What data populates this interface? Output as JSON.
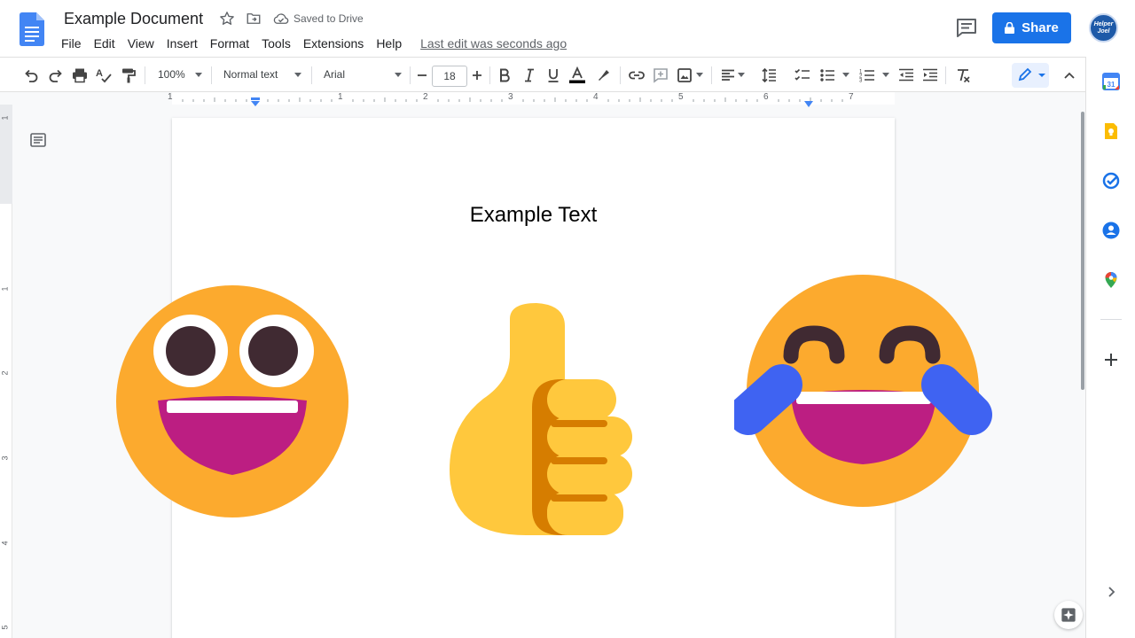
{
  "document": {
    "title": "Example Document",
    "save_status": "Saved to Drive",
    "last_edit": "Last edit was seconds ago",
    "body_heading": "Example Text"
  },
  "menu": [
    "File",
    "Edit",
    "View",
    "Insert",
    "Format",
    "Tools",
    "Extensions",
    "Help"
  ],
  "header": {
    "share_label": "Share",
    "avatar_text": "Helper Joel"
  },
  "toolbar": {
    "zoom": "100%",
    "paragraph_style": "Normal text",
    "font": "Arial",
    "font_size": "18"
  },
  "ruler": {
    "horizontal_labels": [
      "1",
      "1",
      "2",
      "3",
      "4",
      "5",
      "6",
      "7"
    ],
    "vertical_labels": [
      "1",
      "1",
      "2",
      "3",
      "4",
      "5"
    ]
  },
  "side_panel": [
    "calendar-icon",
    "keep-icon",
    "tasks-icon",
    "contacts-icon",
    "maps-icon",
    "add-icon"
  ],
  "colors": {
    "accent": "#1a73e8",
    "emoji_yellow": "#fcaa2e",
    "emoji_mouth": "#bc1e82",
    "thumb_yellow": "#ffc83d",
    "tear_blue": "#3f63f2"
  }
}
